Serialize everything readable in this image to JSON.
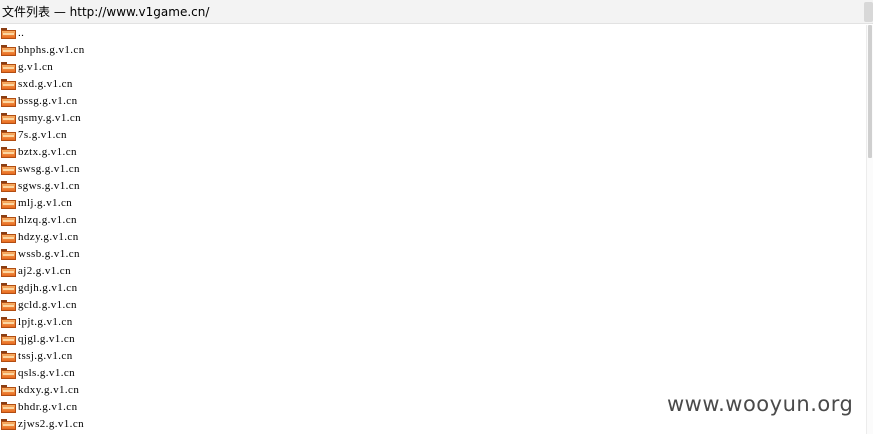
{
  "window": {
    "title": "文件列表 — http://www.v1game.cn/"
  },
  "entries": [
    {
      "label": "..",
      "icon": "folder-icon"
    },
    {
      "label": "bhphs.g.v1.cn",
      "icon": "folder-icon"
    },
    {
      "label": "g.v1.cn",
      "icon": "folder-icon"
    },
    {
      "label": "sxd.g.v1.cn",
      "icon": "folder-icon"
    },
    {
      "label": "bssg.g.v1.cn",
      "icon": "folder-icon"
    },
    {
      "label": "qsmy.g.v1.cn",
      "icon": "folder-icon"
    },
    {
      "label": "7s.g.v1.cn",
      "icon": "folder-icon"
    },
    {
      "label": "bztx.g.v1.cn",
      "icon": "folder-icon"
    },
    {
      "label": "swsg.g.v1.cn",
      "icon": "folder-icon"
    },
    {
      "label": "sgws.g.v1.cn",
      "icon": "folder-icon"
    },
    {
      "label": "mlj.g.v1.cn",
      "icon": "folder-icon"
    },
    {
      "label": "hlzq.g.v1.cn",
      "icon": "folder-icon"
    },
    {
      "label": "hdzy.g.v1.cn",
      "icon": "folder-icon"
    },
    {
      "label": "wssb.g.v1.cn",
      "icon": "folder-icon"
    },
    {
      "label": "aj2.g.v1.cn",
      "icon": "folder-icon"
    },
    {
      "label": "gdjh.g.v1.cn",
      "icon": "folder-icon"
    },
    {
      "label": "gcld.g.v1.cn",
      "icon": "folder-icon"
    },
    {
      "label": "lpjt.g.v1.cn",
      "icon": "folder-icon"
    },
    {
      "label": "qjgl.g.v1.cn",
      "icon": "folder-icon"
    },
    {
      "label": "tssj.g.v1.cn",
      "icon": "folder-icon"
    },
    {
      "label": "qsls.g.v1.cn",
      "icon": "folder-icon"
    },
    {
      "label": "kdxy.g.v1.cn",
      "icon": "folder-icon"
    },
    {
      "label": "bhdr.g.v1.cn",
      "icon": "folder-icon"
    },
    {
      "label": "zjws2.g.v1.cn",
      "icon": "folder-icon"
    }
  ],
  "watermark": {
    "text": "www.wooyun.org"
  },
  "colors": {
    "folder_fill_top": "#f7b066",
    "folder_fill_bottom": "#e86a1e",
    "folder_border": "#b14d12",
    "title_bar_bg": "#f3f3f3",
    "watermark": "#4a4a4a"
  }
}
